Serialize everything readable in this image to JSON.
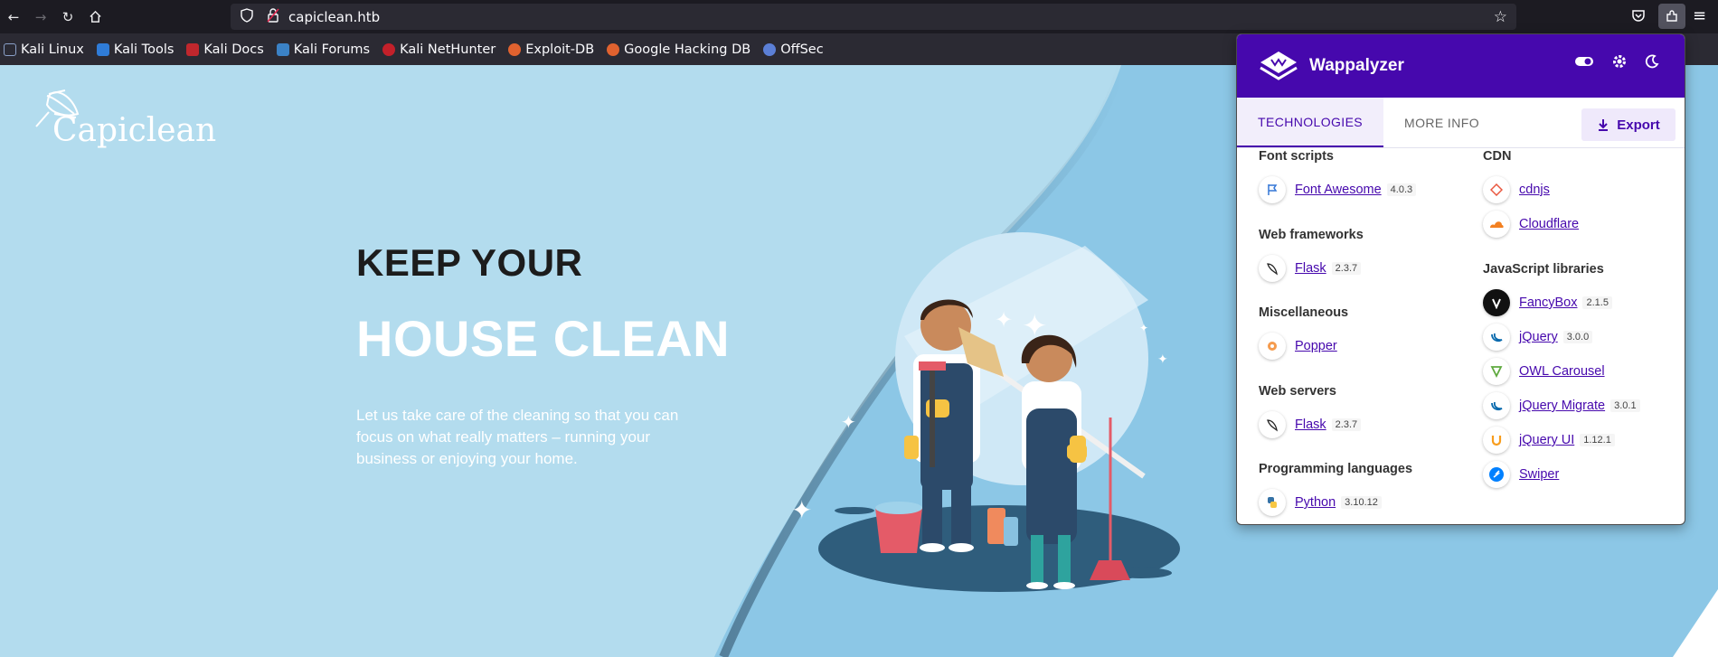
{
  "browser": {
    "url": "capiclean.htb",
    "bookmarks": [
      {
        "label": "Kali Linux",
        "color": "#367bf0"
      },
      {
        "label": "Kali Tools",
        "color": "#2f7cd8"
      },
      {
        "label": "Kali Docs",
        "color": "#c0272d"
      },
      {
        "label": "Kali Forums",
        "color": "#3b82c6"
      },
      {
        "label": "Kali NetHunter",
        "color": "#c3202a"
      },
      {
        "label": "Exploit-DB",
        "color": "#e0622f"
      },
      {
        "label": "Google Hacking DB",
        "color": "#e0622f"
      },
      {
        "label": "OffSec",
        "color": "#5b7fd6"
      }
    ]
  },
  "site": {
    "logo": "Capiclean",
    "headline_1": "KEEP YOUR",
    "headline_2": "HOUSE CLEAN",
    "tagline": "Let us take care of the cleaning so that you can focus on what really matters – running your business or enjoying your home."
  },
  "wappalyzer": {
    "title": "Wappalyzer",
    "tabs": [
      "TECHNOLOGIES",
      "MORE INFO"
    ],
    "export_label": "Export",
    "accent": "#4608ad",
    "left_column": [
      {
        "category": "Font scripts",
        "items": [
          {
            "name": "Font Awesome",
            "version": "4.0.3",
            "icon": "flag-icon"
          }
        ]
      },
      {
        "category": "Web frameworks",
        "items": [
          {
            "name": "Flask",
            "version": "2.3.7",
            "icon": "flask-icon"
          }
        ]
      },
      {
        "category": "Miscellaneous",
        "items": [
          {
            "name": "Popper",
            "version": "",
            "icon": "popper-icon"
          }
        ]
      },
      {
        "category": "Web servers",
        "items": [
          {
            "name": "Flask",
            "version": "2.3.7",
            "icon": "flask-icon"
          }
        ]
      },
      {
        "category": "Programming languages",
        "items": [
          {
            "name": "Python",
            "version": "3.10.12",
            "icon": "python-icon"
          }
        ]
      }
    ],
    "right_column": [
      {
        "category": "CDN",
        "items": [
          {
            "name": "cdnjs",
            "version": "",
            "icon": "cdnjs-icon"
          },
          {
            "name": "Cloudflare",
            "version": "",
            "icon": "cloudflare-icon"
          }
        ]
      },
      {
        "category": "JavaScript libraries",
        "items": [
          {
            "name": "FancyBox",
            "version": "2.1.5",
            "icon": "fancybox-icon"
          },
          {
            "name": "jQuery",
            "version": "3.0.0",
            "icon": "jquery-icon"
          },
          {
            "name": "OWL Carousel",
            "version": "",
            "icon": "owl-icon"
          },
          {
            "name": "jQuery Migrate",
            "version": "3.0.1",
            "icon": "jquery-icon"
          },
          {
            "name": "jQuery UI",
            "version": "1.12.1",
            "icon": "jquery-ui-icon"
          },
          {
            "name": "Swiper",
            "version": "",
            "icon": "swiper-icon"
          }
        ]
      }
    ]
  }
}
